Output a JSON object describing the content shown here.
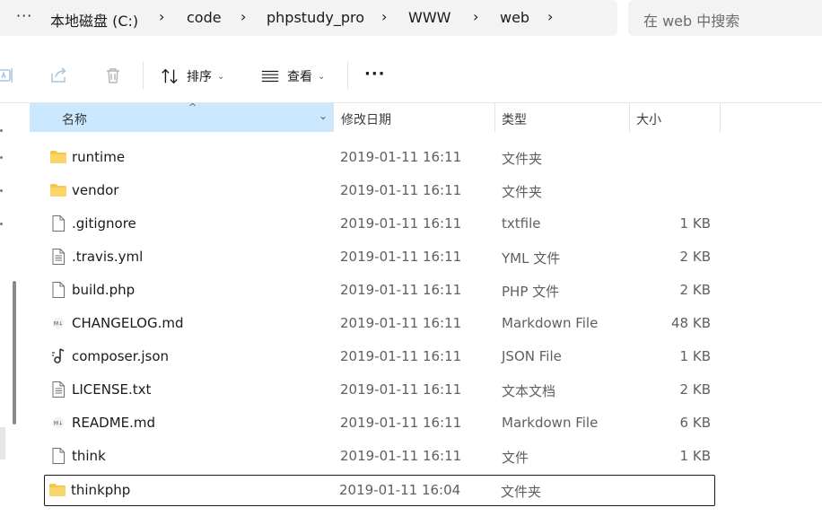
{
  "address": {
    "more": "···",
    "crumbs": [
      "本地磁盘 (C:)",
      "code",
      "phpstudy_pro",
      "WWW",
      "web"
    ],
    "chevron": "›"
  },
  "search": {
    "placeholder": "在 web 中搜索"
  },
  "toolbar": {
    "sort_label": "排序",
    "view_label": "查看",
    "more": "···"
  },
  "columns": {
    "name": "名称",
    "date": "修改日期",
    "type": "类型",
    "size": "大小"
  },
  "files": [
    {
      "name": "runtime",
      "date": "2019-01-11 16:11",
      "type": "文件夹",
      "size": "",
      "icon": "folder-icon"
    },
    {
      "name": "vendor",
      "date": "2019-01-11 16:11",
      "type": "文件夹",
      "size": "",
      "icon": "folder-icon"
    },
    {
      "name": ".gitignore",
      "date": "2019-01-11 16:11",
      "type": "txtfile",
      "size": "1 KB",
      "icon": "blank-file-icon"
    },
    {
      "name": ".travis.yml",
      "date": "2019-01-11 16:11",
      "type": "YML 文件",
      "size": "2 KB",
      "icon": "text-file-icon"
    },
    {
      "name": "build.php",
      "date": "2019-01-11 16:11",
      "type": "PHP 文件",
      "size": "2 KB",
      "icon": "blank-file-icon"
    },
    {
      "name": "CHANGELOG.md",
      "date": "2019-01-11 16:11",
      "type": "Markdown File",
      "size": "48 KB",
      "icon": "markdown-file-icon"
    },
    {
      "name": "composer.json",
      "date": "2019-01-11 16:11",
      "type": "JSON File",
      "size": "1 KB",
      "icon": "json-file-icon"
    },
    {
      "name": "LICENSE.txt",
      "date": "2019-01-11 16:11",
      "type": "文本文档",
      "size": "2 KB",
      "icon": "text-file-icon"
    },
    {
      "name": "README.md",
      "date": "2019-01-11 16:11",
      "type": "Markdown File",
      "size": "6 KB",
      "icon": "markdown-file-icon"
    },
    {
      "name": "think",
      "date": "2019-01-11 16:11",
      "type": "文件",
      "size": "1 KB",
      "icon": "blank-file-icon"
    },
    {
      "name": "thinkphp",
      "date": "2019-01-11 16:04",
      "type": "文件夹",
      "size": "",
      "icon": "folder-icon"
    }
  ],
  "selected_row": 10,
  "colors": {
    "header_selected": "#cce8ff",
    "folder": "#f8c74a",
    "bar_bg": "#f3f3f3"
  }
}
